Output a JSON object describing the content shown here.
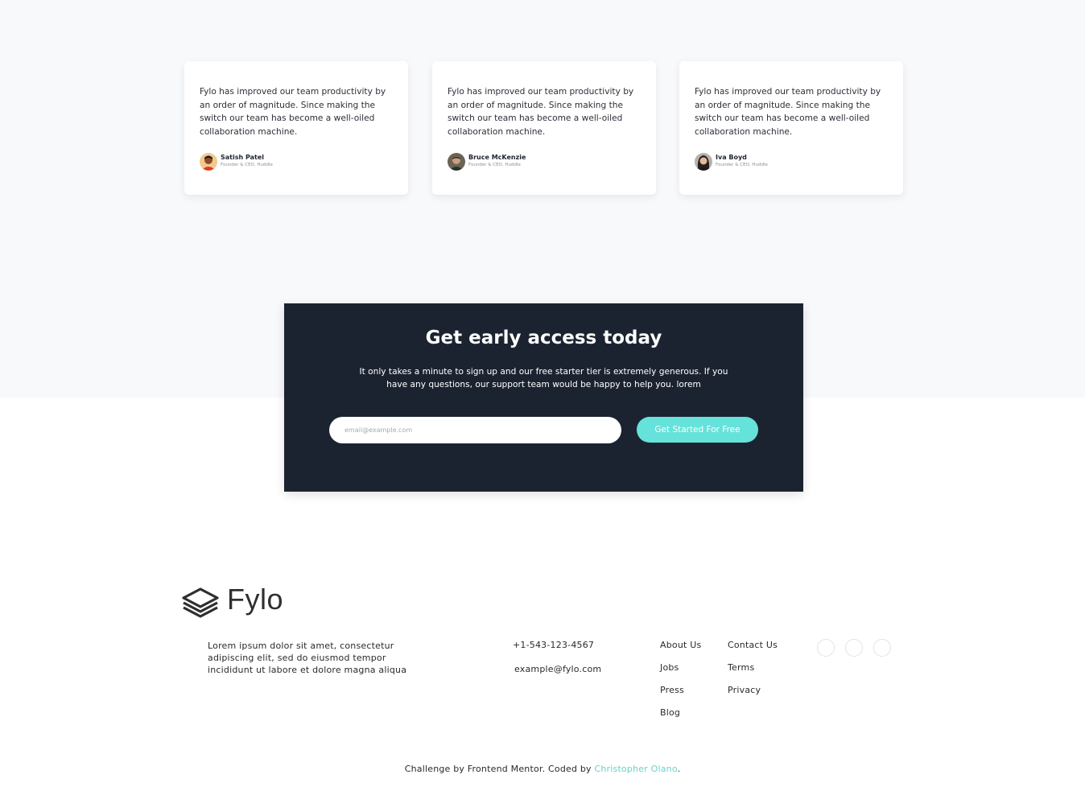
{
  "testimonials": [
    {
      "quote": "Fylo has improved our team productivity by an order of magnitude. Since making the switch our team has become a well-oiled collaboration machine.",
      "name": "Satish Patel",
      "role": "Founder & CEO, Huddle"
    },
    {
      "quote": "Fylo has improved our team productivity by an order of magnitude. Since making the switch our team has become a well-oiled collaboration machine.",
      "name": "Bruce McKenzie",
      "role": "Founder & CEO, Huddle"
    },
    {
      "quote": "Fylo has improved our team productivity by an order of magnitude. Since making the switch our team has become a well-oiled collaboration machine.",
      "name": "Iva Boyd",
      "role": "Founder & CEO, Huddle"
    }
  ],
  "cta": {
    "title": "Get early access today",
    "description": "It only takes a minute to sign up and our free starter tier is extremely generous. If you have any questions, our support team would be happy to help you. lorem",
    "email_placeholder": "email@example.com",
    "email_value": "",
    "button_label": "Get Started For Free"
  },
  "footer": {
    "logo_text": "Fylo",
    "about": "Lorem ipsum dolor sit amet, consectetur adipiscing elit, sed do eiusmod tempor incididunt ut labore et dolore magna aliqua",
    "phone": "+1-543-123-4567",
    "email": "example@fylo.com",
    "links_col1": [
      "About Us",
      "Jobs",
      "Press",
      "Blog"
    ],
    "links_col2": [
      "Contact Us",
      "Terms",
      "Privacy"
    ],
    "social_icons": [
      "facebook-icon",
      "twitter-icon",
      "instagram-icon"
    ]
  },
  "attribution": {
    "prefix": "Challenge by Frontend Mentor. Coded by ",
    "author": "Christopher Olano",
    "suffix": "."
  },
  "colors": {
    "background_band": "#f8f9fb",
    "cta_background": "#1c2330",
    "accent": "#65e2d9",
    "link_accent": "#6ad2c9"
  }
}
